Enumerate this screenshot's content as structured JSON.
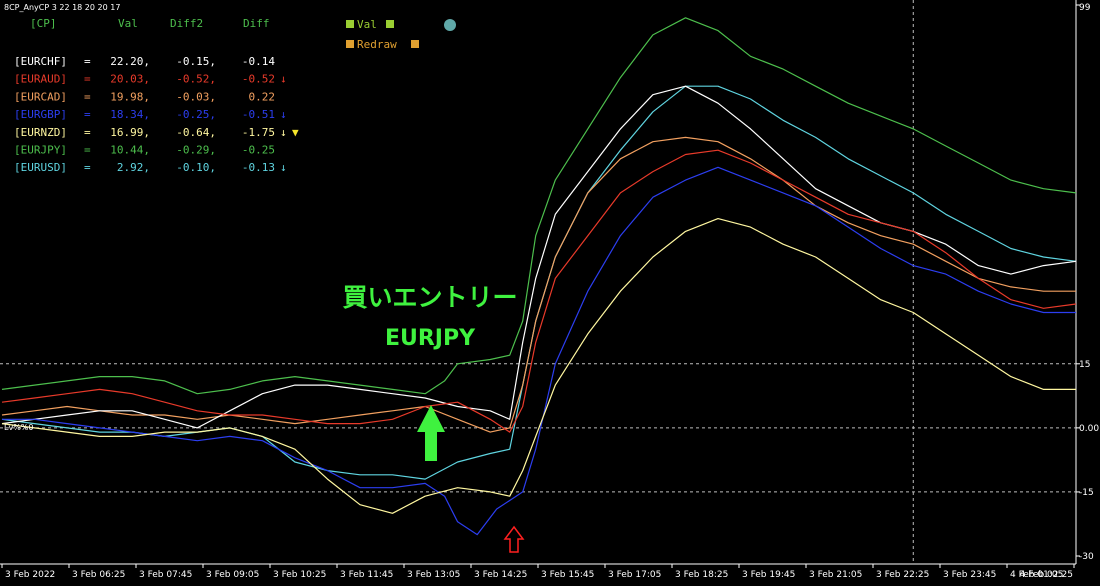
{
  "indicator_title": "8CP_AnyCP 3 22 18 20 20 17",
  "price_label": "Lv%%0",
  "header": {
    "cp": "[CP]",
    "val": "Val",
    "diff2": "Diff2",
    "diff": "Diff"
  },
  "legend": [
    {
      "label": "Val",
      "color": "#9acd32"
    },
    {
      "label": "Redraw",
      "color": "#e0a030"
    }
  ],
  "status_dot_color": "#5fa8a8",
  "rows": [
    {
      "pair": "[EURCHF]",
      "eq": "=",
      "val": "22.20,",
      "diff2": "-0.15,",
      "diff": "-0.14",
      "arrow": "",
      "marker": "",
      "color": "#ffffff"
    },
    {
      "pair": "[EURAUD]",
      "eq": "=",
      "val": "20.03,",
      "diff2": "-0.52,",
      "diff": "-0.52",
      "arrow": "↓",
      "marker": "",
      "color": "#e83a2a"
    },
    {
      "pair": "[EURCAD]",
      "eq": "=",
      "val": "19.98,",
      "diff2": "-0.03,",
      "diff": "0.22",
      "arrow": "",
      "marker": "",
      "color": "#f2a060"
    },
    {
      "pair": "[EURGBP]",
      "eq": "=",
      "val": "18.34,",
      "diff2": "-0.25,",
      "diff": "-0.51",
      "arrow": "↓",
      "marker": "",
      "color": "#2c3ef0"
    },
    {
      "pair": "[EURNZD]",
      "eq": "=",
      "val": "16.99,",
      "diff2": "-0.64,",
      "diff": "-1.75",
      "arrow": "↓",
      "marker": "▼",
      "color": "#fff7a0"
    },
    {
      "pair": "[EURJPY]",
      "eq": "=",
      "val": "10.44,",
      "diff2": "-0.29,",
      "diff": "-0.25",
      "arrow": "",
      "marker": "",
      "color": "#4dbf4d"
    },
    {
      "pair": "[EURUSD]",
      "eq": "=",
      "val": "2.92,",
      "diff2": "-0.10,",
      "diff": "-0.13",
      "arrow": "↓",
      "marker": "",
      "color": "#5fd4e0"
    }
  ],
  "annotation": {
    "line1": "買いエントリー",
    "line2": "EURJPY",
    "color": "#3ff23f"
  },
  "chart_data": {
    "type": "line",
    "title": "",
    "xlabel": "",
    "ylabel": "",
    "x_labels": [
      "3 Feb 2022",
      "3 Feb 06:25",
      "3 Feb 07:45",
      "3 Feb 09:05",
      "3 Feb 10:25",
      "3 Feb 11:45",
      "3 Feb 13:05",
      "3 Feb 14:25",
      "3 Feb 15:45",
      "3 Feb 17:05",
      "3 Feb 18:25",
      "3 Feb 19:45",
      "3 Feb 21:05",
      "3 Feb 22:25",
      "3 Feb 23:45",
      "4 Feb 01:05",
      "4 Feb 02:25"
    ],
    "y_ticks": [
      {
        "value": 99,
        "label": "99"
      },
      {
        "value": 15,
        "label": "15"
      },
      {
        "value": 0,
        "label": "0.00"
      },
      {
        "value": -15,
        "label": "-15"
      },
      {
        "value": -30,
        "label": "-30"
      }
    ],
    "ylim": [
      -30,
      99
    ],
    "grid_levels": [
      15,
      0,
      -15
    ],
    "vline_at": 14,
    "x_min": 0,
    "x_max": 16.5,
    "series": [
      {
        "name": "EURJPY",
        "color": "#4dbf4d",
        "points": [
          [
            0,
            9
          ],
          [
            0.5,
            10
          ],
          [
            1,
            11
          ],
          [
            1.5,
            12
          ],
          [
            2,
            12
          ],
          [
            2.5,
            11
          ],
          [
            3,
            8
          ],
          [
            3.5,
            9
          ],
          [
            4,
            11
          ],
          [
            4.5,
            12
          ],
          [
            5,
            11
          ],
          [
            5.5,
            10
          ],
          [
            6,
            9
          ],
          [
            6.5,
            8
          ],
          [
            6.8,
            11
          ],
          [
            7,
            15
          ],
          [
            7.5,
            16
          ],
          [
            7.8,
            17
          ],
          [
            8,
            25
          ],
          [
            8.2,
            45
          ],
          [
            8.5,
            58
          ],
          [
            9,
            70
          ],
          [
            9.5,
            82
          ],
          [
            10,
            92
          ],
          [
            10.5,
            96
          ],
          [
            11,
            93
          ],
          [
            11.5,
            87
          ],
          [
            12,
            84
          ],
          [
            12.5,
            80
          ],
          [
            13,
            76
          ],
          [
            13.5,
            73
          ],
          [
            14,
            70
          ],
          [
            14.5,
            66
          ],
          [
            15,
            62
          ],
          [
            15.5,
            58
          ],
          [
            16,
            56
          ],
          [
            16.5,
            55
          ]
        ]
      },
      {
        "name": "EURUSD",
        "color": "#5fd4e0",
        "points": [
          [
            0,
            2
          ],
          [
            0.5,
            1
          ],
          [
            1,
            0
          ],
          [
            1.5,
            -1
          ],
          [
            2,
            -1
          ],
          [
            2.5,
            -2
          ],
          [
            3,
            -1
          ],
          [
            3.5,
            0
          ],
          [
            4,
            -2
          ],
          [
            4.5,
            -8
          ],
          [
            5,
            -10
          ],
          [
            5.5,
            -11
          ],
          [
            6,
            -11
          ],
          [
            6.5,
            -12
          ],
          [
            7,
            -8
          ],
          [
            7.5,
            -6
          ],
          [
            7.8,
            -5
          ],
          [
            8,
            10
          ],
          [
            8.2,
            25
          ],
          [
            8.5,
            40
          ],
          [
            9,
            55
          ],
          [
            9.5,
            65
          ],
          [
            10,
            74
          ],
          [
            10.5,
            80
          ],
          [
            11,
            80
          ],
          [
            11.5,
            77
          ],
          [
            12,
            72
          ],
          [
            12.5,
            68
          ],
          [
            13,
            63
          ],
          [
            13.5,
            59
          ],
          [
            14,
            55
          ],
          [
            14.5,
            50
          ],
          [
            15,
            46
          ],
          [
            15.5,
            42
          ],
          [
            16,
            40
          ],
          [
            16.5,
            39
          ]
        ]
      },
      {
        "name": "EURCAD",
        "color": "#f2a060",
        "points": [
          [
            0,
            3
          ],
          [
            0.5,
            4
          ],
          [
            1,
            5
          ],
          [
            1.5,
            4
          ],
          [
            2,
            3
          ],
          [
            2.5,
            3
          ],
          [
            3,
            2
          ],
          [
            3.5,
            3
          ],
          [
            4,
            2
          ],
          [
            4.5,
            1
          ],
          [
            5,
            2
          ],
          [
            5.5,
            3
          ],
          [
            6,
            4
          ],
          [
            6.5,
            5
          ],
          [
            7,
            2
          ],
          [
            7.5,
            -1
          ],
          [
            7.8,
            0
          ],
          [
            8,
            10
          ],
          [
            8.2,
            25
          ],
          [
            8.5,
            40
          ],
          [
            9,
            55
          ],
          [
            9.5,
            63
          ],
          [
            10,
            67
          ],
          [
            10.5,
            68
          ],
          [
            11,
            67
          ],
          [
            11.5,
            63
          ],
          [
            12,
            58
          ],
          [
            12.5,
            52
          ],
          [
            13,
            48
          ],
          [
            13.5,
            45
          ],
          [
            14,
            43
          ],
          [
            14.5,
            39
          ],
          [
            15,
            35
          ],
          [
            15.5,
            33
          ],
          [
            16,
            32
          ],
          [
            16.5,
            32
          ]
        ]
      },
      {
        "name": "EURCHF",
        "color": "#ffffff",
        "points": [
          [
            0,
            1
          ],
          [
            0.5,
            2
          ],
          [
            1,
            3
          ],
          [
            1.5,
            4
          ],
          [
            2,
            4
          ],
          [
            2.5,
            2
          ],
          [
            3,
            0
          ],
          [
            3.5,
            4
          ],
          [
            4,
            8
          ],
          [
            4.5,
            10
          ],
          [
            5,
            10
          ],
          [
            5.5,
            9
          ],
          [
            6,
            8
          ],
          [
            6.5,
            7
          ],
          [
            7,
            5
          ],
          [
            7.5,
            4
          ],
          [
            7.8,
            2
          ],
          [
            8,
            20
          ],
          [
            8.2,
            35
          ],
          [
            8.5,
            50
          ],
          [
            9,
            60
          ],
          [
            9.5,
            70
          ],
          [
            10,
            78
          ],
          [
            10.5,
            80
          ],
          [
            11,
            76
          ],
          [
            11.5,
            70
          ],
          [
            12,
            63
          ],
          [
            12.5,
            56
          ],
          [
            13,
            52
          ],
          [
            13.5,
            48
          ],
          [
            14,
            46
          ],
          [
            14.5,
            43
          ],
          [
            15,
            38
          ],
          [
            15.5,
            36
          ],
          [
            16,
            38
          ],
          [
            16.5,
            39
          ]
        ]
      },
      {
        "name": "EURAUD",
        "color": "#e83a2a",
        "points": [
          [
            0,
            6
          ],
          [
            0.5,
            7
          ],
          [
            1,
            8
          ],
          [
            1.5,
            9
          ],
          [
            2,
            8
          ],
          [
            2.5,
            6
          ],
          [
            3,
            4
          ],
          [
            3.5,
            3
          ],
          [
            4,
            3
          ],
          [
            4.5,
            2
          ],
          [
            5,
            1
          ],
          [
            5.5,
            1
          ],
          [
            6,
            2
          ],
          [
            6.5,
            5
          ],
          [
            7,
            6
          ],
          [
            7.5,
            2
          ],
          [
            7.8,
            -1
          ],
          [
            8,
            5
          ],
          [
            8.2,
            20
          ],
          [
            8.5,
            35
          ],
          [
            9,
            45
          ],
          [
            9.5,
            55
          ],
          [
            10,
            60
          ],
          [
            10.5,
            64
          ],
          [
            11,
            65
          ],
          [
            11.5,
            62
          ],
          [
            12,
            58
          ],
          [
            12.5,
            54
          ],
          [
            13,
            50
          ],
          [
            13.5,
            48
          ],
          [
            14,
            46
          ],
          [
            14.5,
            41
          ],
          [
            15,
            35
          ],
          [
            15.5,
            30
          ],
          [
            16,
            28
          ],
          [
            16.5,
            29
          ]
        ]
      },
      {
        "name": "EURGBP",
        "color": "#2c3ef0",
        "points": [
          [
            0,
            2
          ],
          [
            0.5,
            2
          ],
          [
            1,
            1
          ],
          [
            1.5,
            0
          ],
          [
            2,
            -1
          ],
          [
            2.5,
            -2
          ],
          [
            3,
            -3
          ],
          [
            3.5,
            -2
          ],
          [
            4,
            -3
          ],
          [
            4.5,
            -7
          ],
          [
            5,
            -10
          ],
          [
            5.5,
            -14
          ],
          [
            6,
            -14
          ],
          [
            6.5,
            -13
          ],
          [
            6.8,
            -16
          ],
          [
            7,
            -22
          ],
          [
            7.3,
            -25
          ],
          [
            7.6,
            -19
          ],
          [
            7.8,
            -17
          ],
          [
            8,
            -15
          ],
          [
            8.2,
            -5
          ],
          [
            8.5,
            15
          ],
          [
            9,
            32
          ],
          [
            9.5,
            45
          ],
          [
            10,
            54
          ],
          [
            10.5,
            58
          ],
          [
            11,
            61
          ],
          [
            11.5,
            58
          ],
          [
            12,
            55
          ],
          [
            12.5,
            52
          ],
          [
            13,
            47
          ],
          [
            13.5,
            42
          ],
          [
            14,
            38
          ],
          [
            14.5,
            36
          ],
          [
            15,
            32
          ],
          [
            15.5,
            29
          ],
          [
            16,
            27
          ],
          [
            16.5,
            27
          ]
        ]
      },
      {
        "name": "EURNZD",
        "color": "#fff7a0",
        "points": [
          [
            0,
            1
          ],
          [
            0.5,
            0
          ],
          [
            1,
            -1
          ],
          [
            1.5,
            -2
          ],
          [
            2,
            -2
          ],
          [
            2.5,
            -1
          ],
          [
            3,
            -1
          ],
          [
            3.5,
            0
          ],
          [
            4,
            -2
          ],
          [
            4.5,
            -5
          ],
          [
            5,
            -12
          ],
          [
            5.5,
            -18
          ],
          [
            6,
            -20
          ],
          [
            6.5,
            -16
          ],
          [
            7,
            -14
          ],
          [
            7.5,
            -15
          ],
          [
            7.8,
            -16
          ],
          [
            8,
            -10
          ],
          [
            8.2,
            -2
          ],
          [
            8.5,
            10
          ],
          [
            9,
            22
          ],
          [
            9.5,
            32
          ],
          [
            10,
            40
          ],
          [
            10.5,
            46
          ],
          [
            11,
            49
          ],
          [
            11.5,
            47
          ],
          [
            12,
            43
          ],
          [
            12.5,
            40
          ],
          [
            13,
            35
          ],
          [
            13.5,
            30
          ],
          [
            14,
            27
          ],
          [
            14.5,
            22
          ],
          [
            15,
            17
          ],
          [
            15.5,
            12
          ],
          [
            16,
            9
          ],
          [
            16.5,
            9
          ]
        ]
      }
    ]
  }
}
